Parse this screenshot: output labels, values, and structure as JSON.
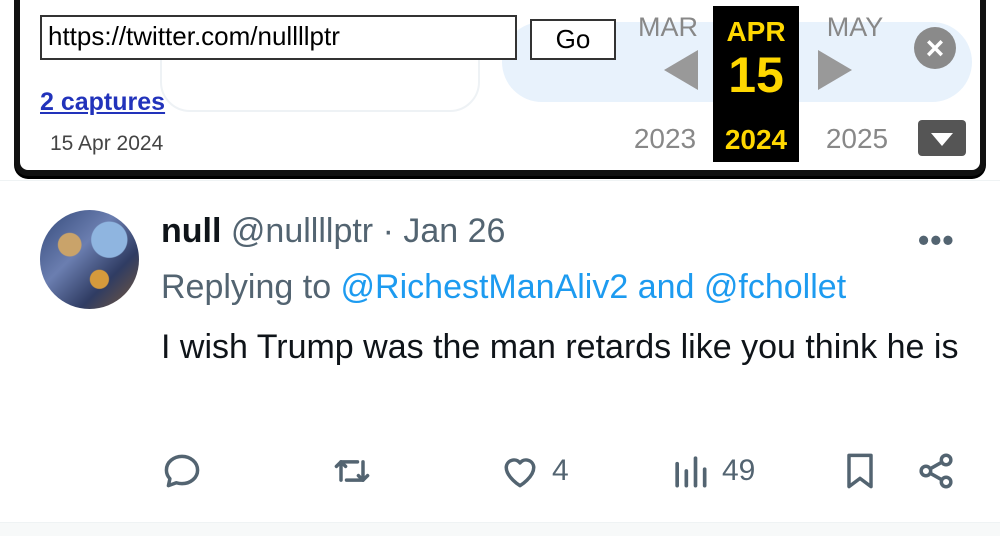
{
  "wayback": {
    "url": "https://twitter.com/nullllptr",
    "go_label": "Go",
    "captures_label": "2 captures",
    "capture_date": "15 Apr 2024",
    "months": {
      "prev": "MAR",
      "current": "APR",
      "next": "MAY"
    },
    "day": "15",
    "years": {
      "prev": "2023",
      "current": "2024",
      "next": "2025"
    },
    "accent_color": "#ffd700"
  },
  "tweet": {
    "display_name": "null",
    "handle": "@nullllptr",
    "separator": " · ",
    "date": "Jan 26",
    "more_label": "•••",
    "replying_prefix": "Replying to ",
    "reply_to_1": "@RichestManAliv2",
    "reply_and": " and ",
    "reply_to_2": "@fchollet",
    "text": "I wish Trump was the man retards like you think he is",
    "likes": "4",
    "views": "49"
  }
}
